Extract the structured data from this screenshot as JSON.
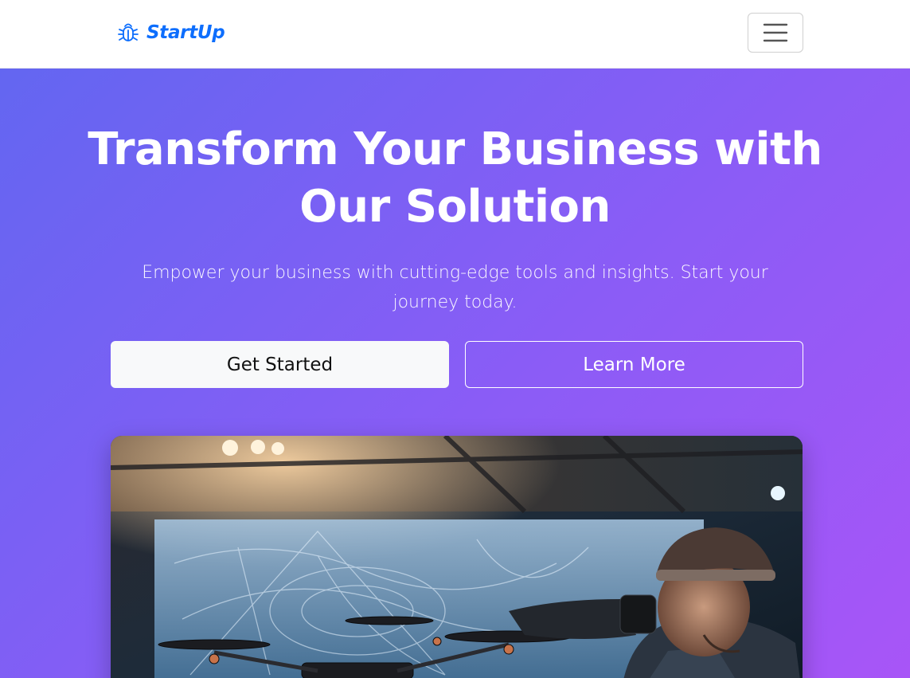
{
  "navbar": {
    "brand": "StartUp",
    "brand_icon": "bug-icon",
    "toggle_icon": "hamburger-menu-icon",
    "brand_color": "#0d6efd"
  },
  "hero": {
    "title": "Transform Your Business with Our Solution",
    "subtitle": "Empower your business with cutting-edge tools and insights. Start your journey today.",
    "primary_button": "Get Started",
    "secondary_button": "Learn More",
    "gradient_start": "#6366f1",
    "gradient_end": "#a855f7",
    "image_subject": "person-with-vr-headset-and-drone-photo"
  }
}
